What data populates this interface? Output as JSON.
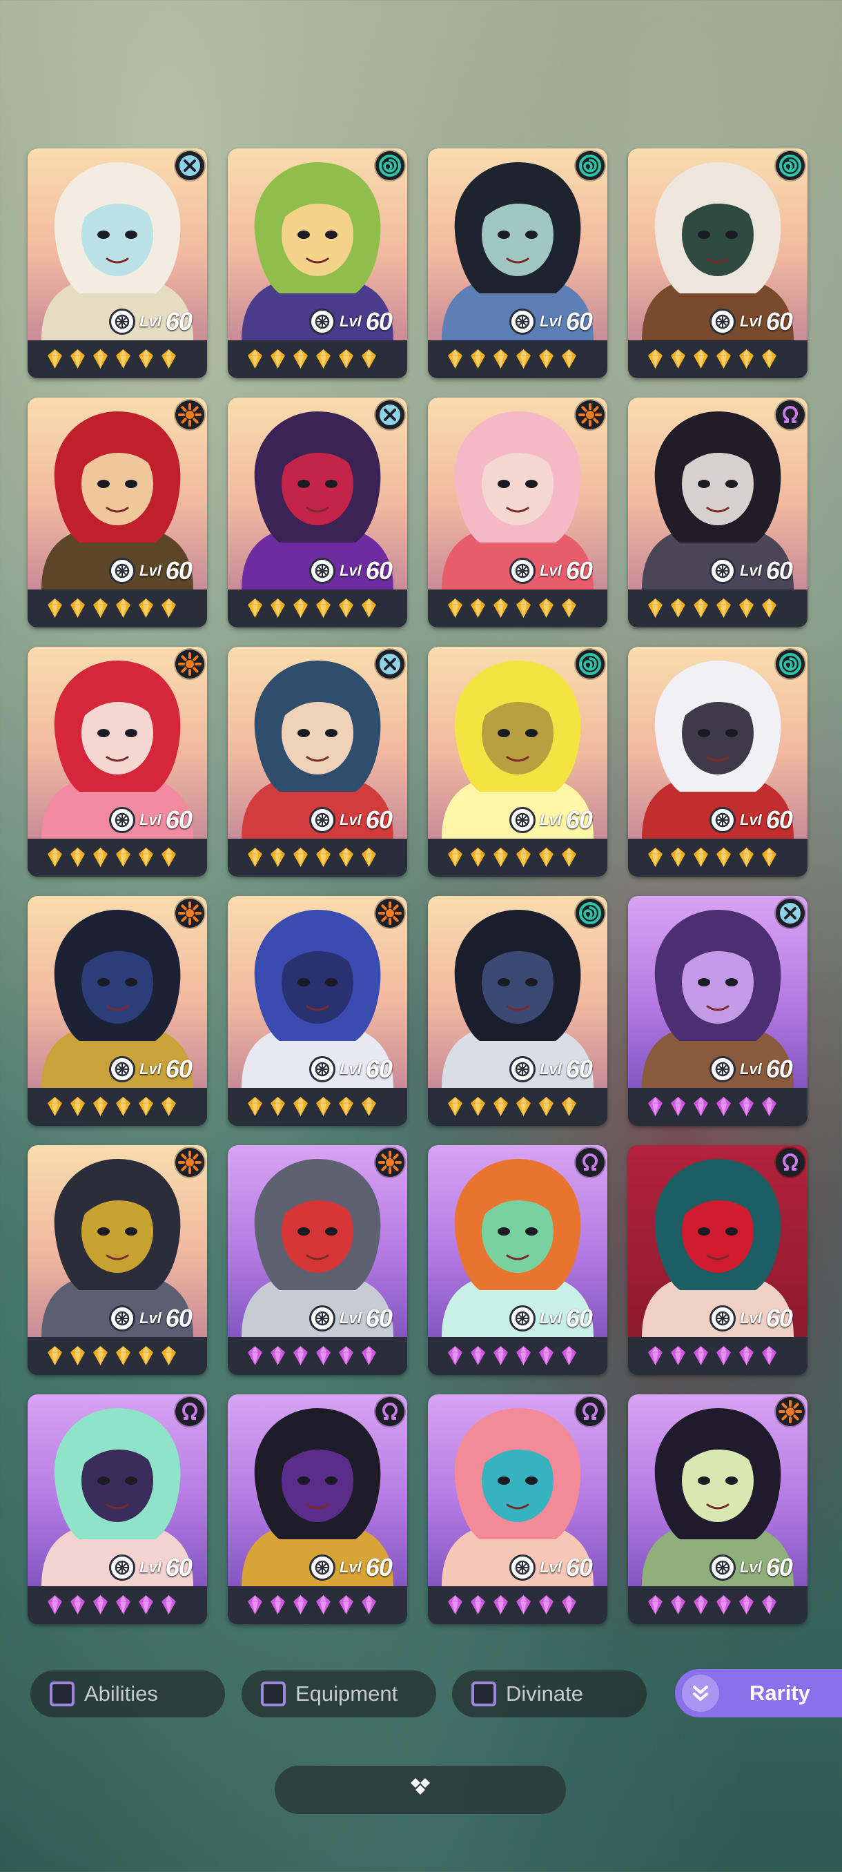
{
  "heroes": [
    {
      "level": "60",
      "rarity": "gold",
      "element": "cross",
      "colors": [
        "#f2ede0",
        "#e6dcc2",
        "#b9e1e6"
      ]
    },
    {
      "level": "60",
      "rarity": "gold",
      "element": "spiral",
      "colors": [
        "#8fbf4a",
        "#4a3b8c",
        "#f3d28a"
      ]
    },
    {
      "level": "60",
      "rarity": "gold",
      "element": "spiral",
      "colors": [
        "#1e2330",
        "#5d7fb6",
        "#9fc6c0"
      ]
    },
    {
      "level": "60",
      "rarity": "gold",
      "element": "spiral",
      "colors": [
        "#ece6dd",
        "#7a4a2c",
        "#2f4a40"
      ]
    },
    {
      "level": "60",
      "rarity": "gold",
      "element": "sun",
      "colors": [
        "#c0202b",
        "#5b4628",
        "#f0c79a"
      ]
    },
    {
      "level": "60",
      "rarity": "gold",
      "element": "cross",
      "colors": [
        "#3b2455",
        "#6d2da0",
        "#c5244a"
      ]
    },
    {
      "level": "60",
      "rarity": "gold",
      "element": "sun",
      "colors": [
        "#f5b8c6",
        "#e85d6c",
        "#f3d7d0"
      ]
    },
    {
      "level": "60",
      "rarity": "gold",
      "element": "omega",
      "colors": [
        "#201d28",
        "#4a4658",
        "#d6d0cf"
      ]
    },
    {
      "level": "60",
      "rarity": "gold",
      "element": "sun",
      "colors": [
        "#d6263a",
        "#f08ba0",
        "#f3d7d0"
      ]
    },
    {
      "level": "60",
      "rarity": "gold",
      "element": "cross",
      "colors": [
        "#2f4d6d",
        "#d23c3c",
        "#f0d2b8"
      ]
    },
    {
      "level": "60",
      "rarity": "gold",
      "element": "spiral",
      "colors": [
        "#f4e442",
        "#fff6a8",
        "#b8a040"
      ]
    },
    {
      "level": "60",
      "rarity": "gold",
      "element": "spiral",
      "colors": [
        "#f0f0f5",
        "#c22d2d",
        "#3e3a48"
      ]
    },
    {
      "level": "60",
      "rarity": "gold",
      "element": "sun",
      "colors": [
        "#1c2236",
        "#c9a23a",
        "#2c3e7a"
      ]
    },
    {
      "level": "60",
      "rarity": "gold",
      "element": "sun",
      "colors": [
        "#3a4cb0",
        "#e8e8f2",
        "#2a3170"
      ]
    },
    {
      "level": "60",
      "rarity": "gold",
      "element": "spiral",
      "colors": [
        "#1a1d2c",
        "#d9dde6",
        "#3a4a74"
      ]
    },
    {
      "level": "60",
      "rarity": "purple",
      "element": "cross",
      "colors": [
        "#4c2e73",
        "#8a5a3d",
        "#c39ae5"
      ]
    },
    {
      "level": "60",
      "rarity": "gold",
      "element": "sun",
      "colors": [
        "#2b2d3a",
        "#5a6072",
        "#c7a230"
      ]
    },
    {
      "level": "60",
      "rarity": "purple",
      "element": "sun",
      "colors": [
        "#5e6270",
        "#c7ccd4",
        "#d63636"
      ]
    },
    {
      "level": "60",
      "rarity": "purple",
      "element": "omega",
      "colors": [
        "#e9742f",
        "#c8f0e6",
        "#7ad1a0"
      ]
    },
    {
      "level": "60",
      "rarity": "red",
      "element": "omega",
      "colors": [
        "#1b5f62",
        "#f0d0c4",
        "#d01c2e"
      ]
    },
    {
      "level": "60",
      "rarity": "purple",
      "element": "omega",
      "colors": [
        "#8fe3c8",
        "#f3d2d0",
        "#3a2d5c"
      ]
    },
    {
      "level": "60",
      "rarity": "purple",
      "element": "omega",
      "colors": [
        "#1f1c2a",
        "#d9a437",
        "#5b2d8a"
      ]
    },
    {
      "level": "60",
      "rarity": "purple",
      "element": "omega",
      "colors": [
        "#f28a98",
        "#f6c7b6",
        "#37b3c0"
      ]
    },
    {
      "level": "60",
      "rarity": "purple",
      "element": "sun",
      "colors": [
        "#1f1a2c",
        "#8fb07a",
        "#d8e8b0"
      ]
    }
  ],
  "level_label": "Lvl",
  "filters": [
    {
      "label": "Abilities"
    },
    {
      "label": "Equipment"
    },
    {
      "label": "Divinate"
    }
  ],
  "sort": {
    "label": "Rarity",
    "icon": "double-chevron-down-icon"
  },
  "expand_icon": "diamond-cluster-icon",
  "colors": {
    "gem_gold": "#f5b521",
    "gem_purple": "#d65ce8",
    "spiral": "#2ec4a6",
    "cross": "#8fd3e8",
    "sun": "#f07c1f",
    "omega": "#c87ce8",
    "accent": "#8b70ec"
  }
}
